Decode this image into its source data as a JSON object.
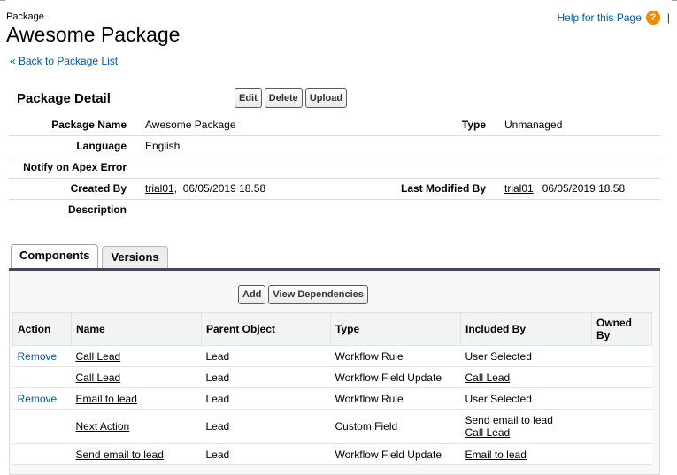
{
  "header": {
    "page_type": "Package",
    "title": "Awesome Package",
    "help_link": "Help for this Page",
    "help_icon_glyph": "?",
    "separator": "|",
    "back_link": "« Back to Package List"
  },
  "detail": {
    "section_title": "Package Detail",
    "buttons": {
      "edit": "Edit",
      "delete": "Delete",
      "upload": "Upload"
    },
    "fields": {
      "package_name_label": "Package Name",
      "package_name_value": "Awesome Package",
      "type_label": "Type",
      "type_value": "Unmanaged",
      "language_label": "Language",
      "language_value": "English",
      "notify_label": "Notify on Apex Error",
      "created_by_label": "Created By",
      "created_by_user": "trial01",
      "created_by_date": ",  06/05/2019 18.58",
      "last_modified_label": "Last Modified By",
      "last_modified_user": "trial01",
      "last_modified_date": ",  06/05/2019 18.58",
      "description_label": "Description"
    }
  },
  "tabs": [
    {
      "label": "Components",
      "active": true
    },
    {
      "label": "Versions",
      "active": false
    }
  ],
  "components": {
    "buttons": {
      "add": "Add",
      "view_dependencies": "View Dependencies"
    },
    "columns": [
      "Action",
      "Name",
      "Parent Object",
      "Type",
      "Included By",
      "Owned By"
    ],
    "rows": [
      {
        "action": "Remove",
        "name": "Call Lead",
        "parent": "Lead",
        "type": "Workflow Rule",
        "included_by": [
          "User Selected"
        ],
        "included_is_link": false,
        "owned_by": ""
      },
      {
        "action": "",
        "name": "Call Lead",
        "parent": "Lead",
        "type": "Workflow Field Update",
        "included_by": [
          "Call Lead"
        ],
        "included_is_link": true,
        "owned_by": ""
      },
      {
        "action": "Remove",
        "name": "Email to lead",
        "parent": "Lead",
        "type": "Workflow Rule",
        "included_by": [
          "User Selected"
        ],
        "included_is_link": false,
        "owned_by": ""
      },
      {
        "action": "",
        "name": "Next Action",
        "parent": "Lead",
        "type": "Custom Field",
        "included_by": [
          "Send email to lead",
          "Call Lead"
        ],
        "included_is_link": true,
        "owned_by": ""
      },
      {
        "action": "",
        "name": "Send email to lead",
        "parent": "Lead",
        "type": "Workflow Field Update",
        "included_by": [
          "Email to lead"
        ],
        "included_is_link": true,
        "owned_by": ""
      }
    ]
  },
  "colors": {
    "link_blue": "#015ba7",
    "help_icon_orange": "#f08a00",
    "tab_bar": "#3e4b5b"
  }
}
